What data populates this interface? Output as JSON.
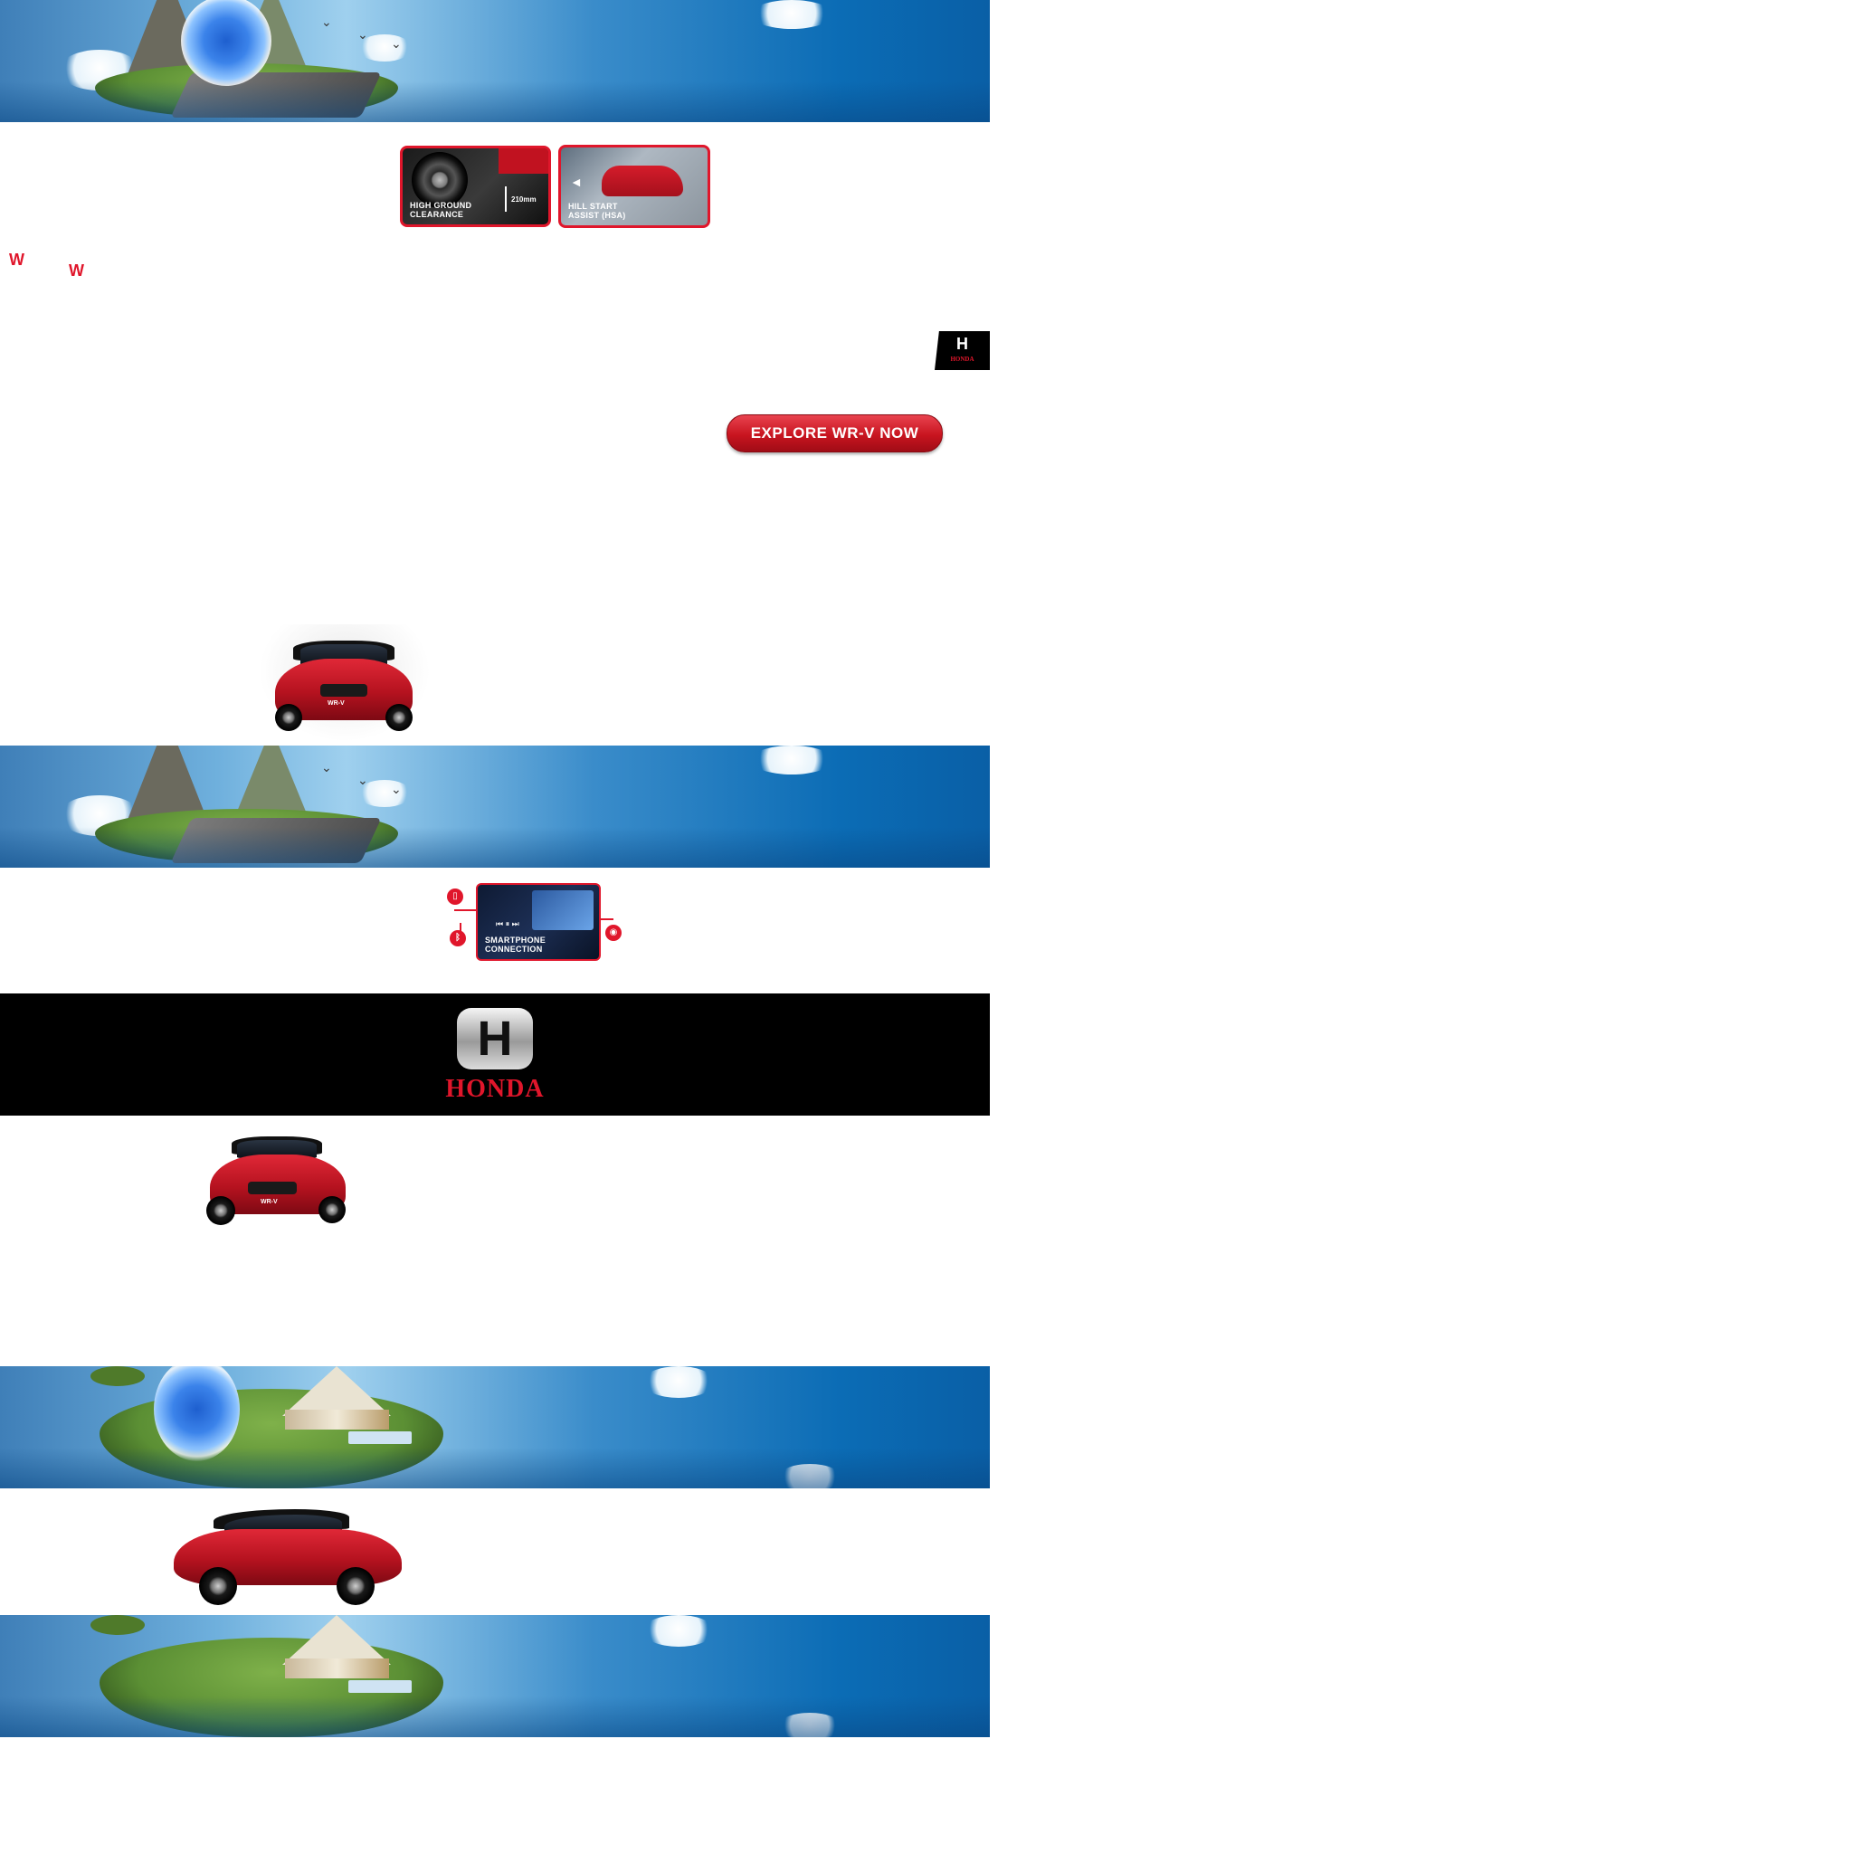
{
  "features": {
    "ground_clearance": {
      "label": "HIGH GROUND\nCLEARANCE",
      "measure": "210mm"
    },
    "hill_start": {
      "label": "HILL START\nASSIST (HSA)"
    },
    "smartphone": {
      "label": "SMARTPHONE\nCONNECTION"
    }
  },
  "decor": {
    "w1": "W",
    "w2": "W"
  },
  "brand": {
    "name": "HONDA",
    "mark": "H"
  },
  "cta": {
    "label": "EXPLORE WR-V NOW"
  },
  "car": {
    "badge": "WR-V"
  },
  "colors": {
    "brand_red": "#e0162b",
    "sky_blue": "#0b6cb5",
    "black": "#000000"
  },
  "icons": {
    "phone": "phone-icon",
    "bluetooth": "bluetooth-icon",
    "audio": "audio-icon"
  }
}
